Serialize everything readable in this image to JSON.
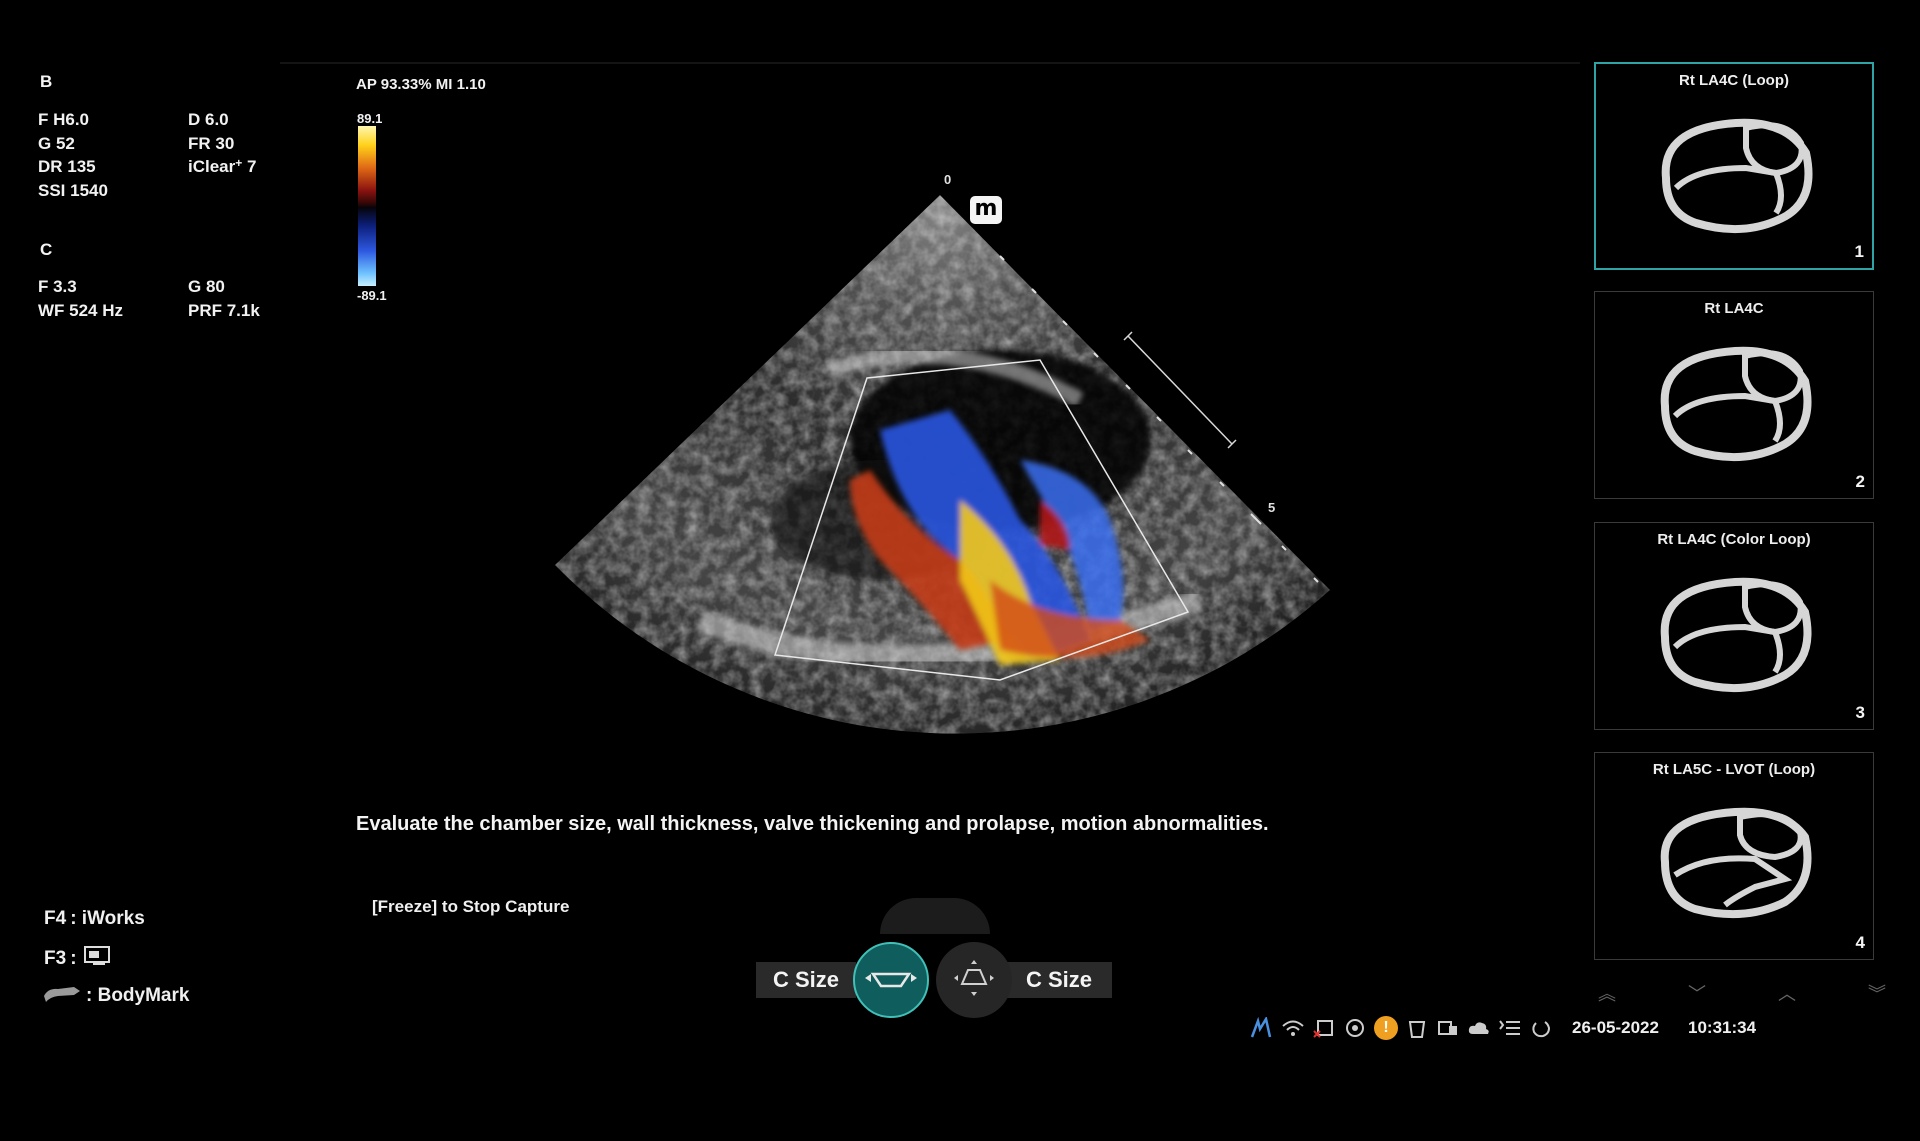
{
  "params": {
    "b_header": "B",
    "b_left": [
      "F H6.0",
      "G 52",
      "DR 135",
      "SSI 1540"
    ],
    "b_right": [
      "D 6.0",
      "FR 30"
    ],
    "iclear_text": "iClear",
    "iclear_sup": "+",
    "iclear_value": "7",
    "c_header": "C",
    "c_left": [
      "F 3.3",
      "WF 524 Hz"
    ],
    "c_right": [
      "G 80",
      "PRF 7.1k"
    ]
  },
  "acoustic": {
    "ap_mi": "AP 93.33%  MI 1.10"
  },
  "colorbar": {
    "max": "89.1",
    "min": "-89.1"
  },
  "depth": {
    "top": "0",
    "mid": "5"
  },
  "logo": {
    "letter": "m"
  },
  "instruction": "Evaluate the chamber size, wall thickness, valve thickening and prolapse, motion abnormalities.",
  "freeze_hint": "[Freeze] to Stop Capture",
  "shortcuts": {
    "f4_key": "F4",
    "f4_label": ": iWorks",
    "f3_key": "F3",
    "f3_sep": ":",
    "bodymark_label": ": BodyMark"
  },
  "controls": {
    "left_label": "C Size",
    "right_label": "C Size"
  },
  "thumbnails": [
    {
      "title": "Rt LA4C (Loop)",
      "number": "1"
    },
    {
      "title": "Rt LA4C",
      "number": "2"
    },
    {
      "title": "Rt LA4C (Color Loop)",
      "number": "3"
    },
    {
      "title": "Rt LA5C - LVOT (Loop)",
      "number": "4"
    }
  ],
  "status": {
    "date": "26-05-2022",
    "time": "10:31:34",
    "warning_glyph": "!"
  },
  "colors": {
    "accent": "#2fa4a6",
    "active_knob": "#0f5d5c",
    "warning": "#f0a020"
  }
}
